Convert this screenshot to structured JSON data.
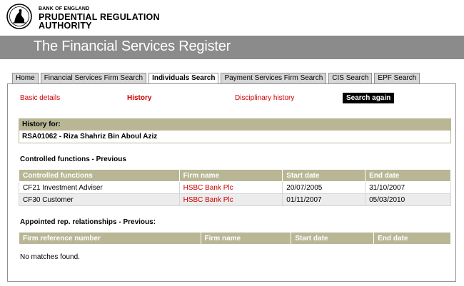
{
  "header": {
    "org_small": "BANK OF ENGLAND",
    "org_line1": "PRUDENTIAL REGULATION",
    "org_line2": "AUTHORITY",
    "title": "The Financial Services Register"
  },
  "tabs": [
    {
      "label": "Home",
      "active": false
    },
    {
      "label": "Financial Services Firm Search",
      "active": false
    },
    {
      "label": "Individuals Search",
      "active": true
    },
    {
      "label": "Payment Services Firm Search",
      "active": false
    },
    {
      "label": "CIS Search",
      "active": false
    },
    {
      "label": "EPF Search",
      "active": false
    }
  ],
  "subnav": {
    "basic": "Basic details",
    "history": "History",
    "disciplinary": "Disciplinary history",
    "search_again": "Search again"
  },
  "history": {
    "label": "History for:",
    "value": "RSA01062 - Riza Shahriz Bin Aboul Aziz"
  },
  "controlled": {
    "title": "Controlled functions - Previous",
    "headers": [
      "Controlled functions",
      "Firm name",
      "Start date",
      "End date"
    ],
    "rows": [
      [
        "CF21 Investment Adviser",
        "HSBC Bank Plc",
        "20/07/2005",
        "31/10/2007"
      ],
      [
        "CF30 Customer",
        "HSBC Bank Plc",
        "01/11/2007",
        "05/03/2010"
      ]
    ]
  },
  "appointed": {
    "title": "Appointed rep. relationships - Previous:",
    "headers": [
      "Firm reference number",
      "Firm name",
      "Start date",
      "End date"
    ],
    "empty": "No matches found."
  },
  "colors": {
    "accent_red": "#cc0000",
    "table_header": "#b8b695",
    "title_bar": "#8b8b8b"
  }
}
